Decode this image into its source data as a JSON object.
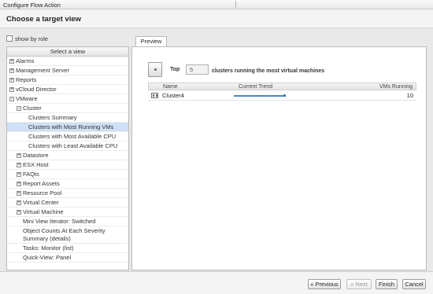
{
  "window": {
    "title": "Configure Flow Action"
  },
  "header": {
    "title": "Choose a target view"
  },
  "left": {
    "show_by_role": {
      "label": "show by role",
      "checked": false
    },
    "panel_header": "Select a view",
    "tree": [
      {
        "label": "Alarms",
        "expander": "+",
        "level": 0
      },
      {
        "label": "Management Server",
        "expander": "+",
        "level": 0
      },
      {
        "label": "Reports",
        "expander": "+",
        "level": 0
      },
      {
        "label": "vCloud Director",
        "expander": "+",
        "level": 0
      },
      {
        "label": "VMware",
        "expander": "-",
        "level": 0
      },
      {
        "label": "Cluster",
        "expander": "-",
        "level": 1
      },
      {
        "label": "Clusters Summary",
        "level": 2
      },
      {
        "label": "Clusters with Most Running VMs",
        "level": 2,
        "selected": true
      },
      {
        "label": "Clusters with Most Available CPU",
        "level": 2
      },
      {
        "label": "Clusters with Least Available CPU",
        "level": 2
      },
      {
        "label": "Datastore",
        "expander": "+",
        "level": 1
      },
      {
        "label": "ESX Host",
        "expander": "+",
        "level": 1
      },
      {
        "label": "FAQts",
        "expander": "+",
        "level": 1
      },
      {
        "label": "Report Assets",
        "expander": "+",
        "level": 1
      },
      {
        "label": "Resource Pool",
        "expander": "+",
        "level": 1
      },
      {
        "label": "Virtual Center",
        "expander": "+",
        "level": 1
      },
      {
        "label": "Virtual Machine",
        "expander": "+",
        "level": 1
      },
      {
        "label": "Mini View Iterator: Switched",
        "level": 1
      },
      {
        "label": "Object Counts At Each Severity Summary (details)",
        "level": 1
      },
      {
        "label": "Tasks: Monitor (list)",
        "level": 1
      },
      {
        "label": "Quick-View: Panel",
        "level": 1
      }
    ]
  },
  "preview": {
    "tab_label": "Preview",
    "top_label": "Top",
    "top_count": "5",
    "top_tail": "clusters running the most virtual machines",
    "columns": [
      "Name",
      "Current Trend",
      "VMs Running"
    ],
    "rows": [
      {
        "name": "Cluster4",
        "vms_running": "10"
      }
    ],
    "trend_color": "#4a86c8"
  },
  "footer": {
    "previous": "« Previous",
    "next": "» Next",
    "finish": "Finish",
    "cancel": "Cancel"
  }
}
